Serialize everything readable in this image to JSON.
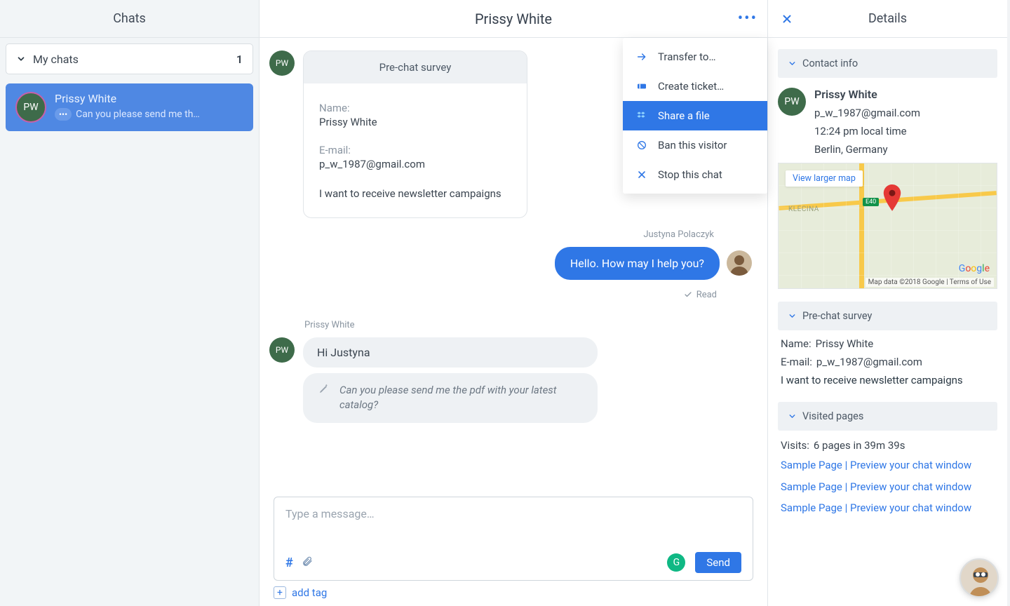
{
  "sidebar": {
    "title": "Chats",
    "my_chats_label": "My chats",
    "my_chats_count": "1",
    "active_chat": {
      "initials": "PW",
      "name": "Prissy White",
      "preview": "Can you please send me th…",
      "typing_chip": "•••"
    }
  },
  "conversation": {
    "title": "Prissy White",
    "survey": {
      "heading": "Pre-chat survey",
      "name_label": "Name:",
      "name_value": "Prissy White",
      "email_label": "E-mail:",
      "email_value": "p_w_1987@gmail.com",
      "note": "I want to receive newsletter campaigns"
    },
    "avatar_initials": "PW",
    "agent_name": "Justyna Polaczyk",
    "agent_message": "Hello. How may I help you?",
    "read_label": "Read",
    "visitor_name": "Prissy White",
    "visitor_message": "Hi Justyna",
    "typing_message": "Can you please send me the pdf with your latest catalog?",
    "composer_placeholder": "Type a message…",
    "send_label": "Send",
    "add_tag_label": "add tag"
  },
  "dropdown": {
    "items": [
      {
        "icon": "arrow-right",
        "label": "Transfer to…"
      },
      {
        "icon": "ticket",
        "label": "Create ticket…"
      },
      {
        "icon": "dropbox",
        "label": "Share a file",
        "selected": true
      },
      {
        "icon": "ban",
        "label": "Ban this visitor"
      },
      {
        "icon": "x",
        "label": "Stop this chat"
      }
    ]
  },
  "details": {
    "title": "Details",
    "contact_heading": "Contact info",
    "contact": {
      "initials": "PW",
      "name": "Prissy White",
      "email": "p_w_1987@gmail.com",
      "time": "12:24 pm local time",
      "location": "Berlin, Germany"
    },
    "map": {
      "larger_label": "View larger map",
      "district": "KLECINA",
      "badge": "E40",
      "logo": "Google",
      "copyright": "Map data ©2018 Google | Terms of Use"
    },
    "prechat_heading": "Pre-chat survey",
    "prechat": {
      "name_label": "Name:",
      "name_value": "Prissy White",
      "email_label": "E-mail:",
      "email_value": "p_w_1987@gmail.com",
      "note": "I want to receive newsletter campaigns"
    },
    "visited_heading": "Visited pages",
    "visits_label": "Visits:",
    "visits_value": "6 pages in 39m 39s",
    "visit_links": [
      "Sample Page | Preview your chat window",
      "Sample Page | Preview your chat window",
      "Sample Page | Preview your chat window"
    ]
  }
}
